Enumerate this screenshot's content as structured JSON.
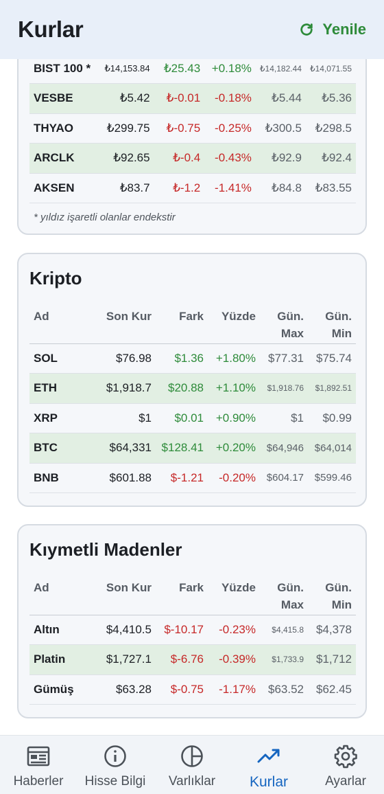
{
  "header": {
    "title": "Kurlar",
    "refresh_label": "Yenile",
    "accent": "#2e8b3a"
  },
  "columns": {
    "name": "Ad",
    "kur": "Son Kur",
    "fark": "Fark",
    "yuzde": "Yüzde",
    "max": "Gün. Max",
    "min": "Gün. Min"
  },
  "stocks": {
    "rows": [
      {
        "name": "BIST 100 *",
        "kur": "₺14,153.84",
        "fark": "₺25.43",
        "yuzde": "+0.18%",
        "max": "₺14,182.44",
        "min": "₺14,071.55",
        "trend": "pos"
      },
      {
        "name": "VESBE",
        "kur": "₺5.42",
        "fark": "₺-0.01",
        "yuzde": "-0.18%",
        "max": "₺5.44",
        "min": "₺5.36",
        "trend": "neg"
      },
      {
        "name": "THYAO",
        "kur": "₺299.75",
        "fark": "₺-0.75",
        "yuzde": "-0.25%",
        "max": "₺300.5",
        "min": "₺298.5",
        "trend": "neg"
      },
      {
        "name": "ARCLK",
        "kur": "₺92.65",
        "fark": "₺-0.4",
        "yuzde": "-0.43%",
        "max": "₺92.9",
        "min": "₺92.4",
        "trend": "neg"
      },
      {
        "name": "AKSEN",
        "kur": "₺83.7",
        "fark": "₺-1.2",
        "yuzde": "-1.41%",
        "max": "₺84.8",
        "min": "₺83.55",
        "trend": "neg"
      }
    ],
    "footnote": "* yıldız işaretli olanlar endekstir"
  },
  "crypto": {
    "title": "Kripto",
    "rows": [
      {
        "name": "SOL",
        "kur": "$76.98",
        "fark": "$1.36",
        "yuzde": "+1.80%",
        "max": "$77.31",
        "min": "$75.74",
        "trend": "pos"
      },
      {
        "name": "ETH",
        "kur": "$1,918.7",
        "fark": "$20.88",
        "yuzde": "+1.10%",
        "max": "$1,918.76",
        "min": "$1,892.51",
        "trend": "pos"
      },
      {
        "name": "XRP",
        "kur": "$1",
        "fark": "$0.01",
        "yuzde": "+0.90%",
        "max": "$1",
        "min": "$0.99",
        "trend": "pos"
      },
      {
        "name": "BTC",
        "kur": "$64,331",
        "fark": "$128.41",
        "yuzde": "+0.20%",
        "max": "$64,946",
        "min": "$64,014",
        "trend": "pos"
      },
      {
        "name": "BNB",
        "kur": "$601.88",
        "fark": "$-1.21",
        "yuzde": "-0.20%",
        "max": "$604.17",
        "min": "$599.46",
        "trend": "neg"
      }
    ]
  },
  "metals": {
    "title": "Kıymetli Madenler",
    "rows": [
      {
        "name": "Altın",
        "kur": "$4,410.5",
        "fark": "$-10.17",
        "yuzde": "-0.23%",
        "max": "$4,415.8",
        "min": "$4,378",
        "trend": "neg"
      },
      {
        "name": "Platin",
        "kur": "$1,727.1",
        "fark": "$-6.76",
        "yuzde": "-0.39%",
        "max": "$1,733.9",
        "min": "$1,712",
        "trend": "neg"
      },
      {
        "name": "Gümüş",
        "kur": "$63.28",
        "fark": "$-0.75",
        "yuzde": "-1.17%",
        "max": "$63.52",
        "min": "$62.45",
        "trend": "neg"
      }
    ]
  },
  "nav": [
    {
      "label": "Haberler",
      "icon": "newspaper-icon"
    },
    {
      "label": "Hisse Bilgi",
      "icon": "info-icon"
    },
    {
      "label": "Varlıklar",
      "icon": "pie-chart-icon"
    },
    {
      "label": "Kurlar",
      "icon": "trending-up-icon",
      "active": true
    },
    {
      "label": "Ayarlar",
      "icon": "gear-icon"
    }
  ]
}
